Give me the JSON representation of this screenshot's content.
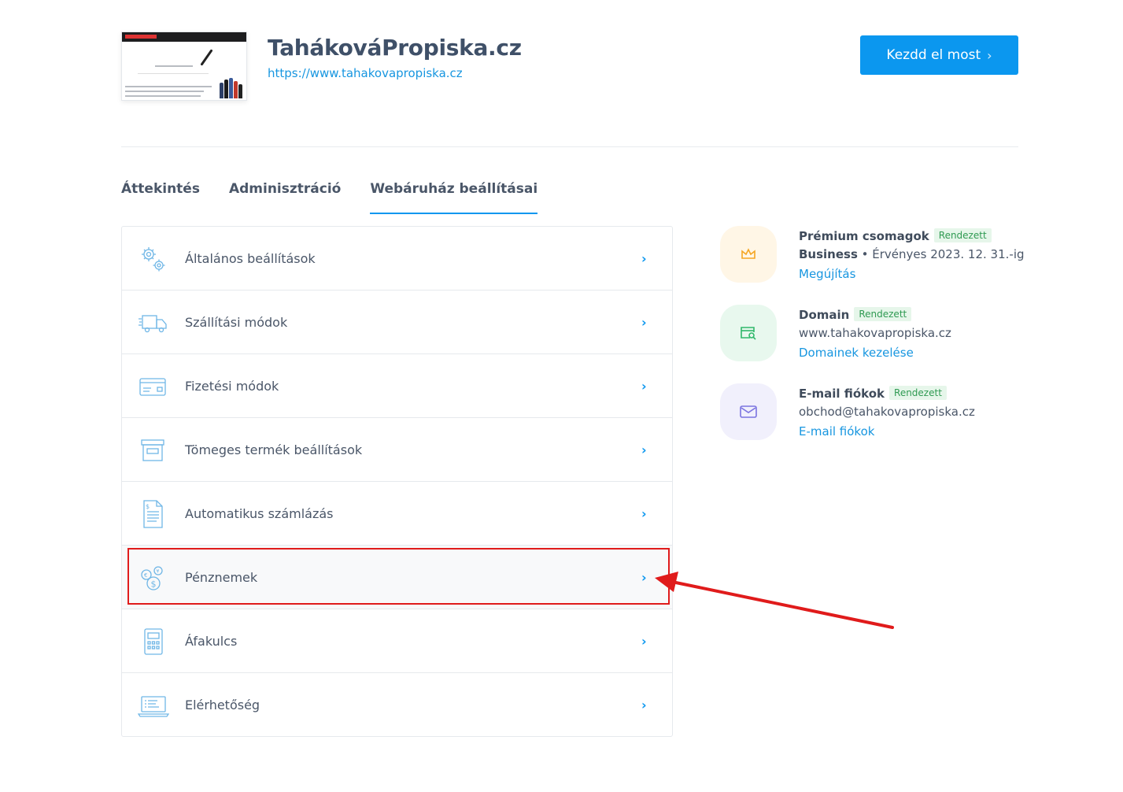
{
  "header": {
    "site_title": "TahákováPropiska.cz",
    "site_url": "https://www.tahakovapropiska.cz",
    "cta_label": "Kezdd el most",
    "cta_icon": "chevron-right-icon"
  },
  "tabs": [
    {
      "label": "Áttekintés",
      "active": false
    },
    {
      "label": "Adminisztráció",
      "active": false
    },
    {
      "label": "Webáruház beállításai",
      "active": true
    }
  ],
  "settings": [
    {
      "label": "Általános beállítások",
      "icon": "gears-icon"
    },
    {
      "label": "Szállítási módok",
      "icon": "truck-icon"
    },
    {
      "label": "Fizetési módok",
      "icon": "credit-card-icon"
    },
    {
      "label": "Tömeges termék beállítások",
      "icon": "box-icon"
    },
    {
      "label": "Automatikus számlázás",
      "icon": "invoice-icon"
    },
    {
      "label": "Pénznemek",
      "icon": "currency-coins-icon"
    },
    {
      "label": "Áfakulcs",
      "icon": "calculator-icon"
    },
    {
      "label": "Elérhetőség",
      "icon": "laptop-icon"
    }
  ],
  "services": [
    {
      "name": "Prémium csomagok",
      "badge": "Rendezett",
      "detail_strong": "Business",
      "detail_rest": " • Érvényes 2023. 12. 31.-ig",
      "link": "Megújítás",
      "icon": "crown-icon",
      "bg": "#fff6e6",
      "color": "#f5a623"
    },
    {
      "name": "Domain",
      "badge": "Rendezett",
      "detail_strong": "",
      "detail_rest": "www.tahakovapropiska.cz",
      "link": "Domainek kezelése",
      "icon": "domain-search-icon",
      "bg": "#e8f8ee",
      "color": "#2fb86a"
    },
    {
      "name": "E-mail fiókok",
      "badge": "Rendezett",
      "detail_strong": "",
      "detail_rest": "obchod@tahakovapropiska.cz",
      "link": "E-mail fiókok",
      "icon": "envelope-icon",
      "bg": "#f1f0fc",
      "color": "#7b74e0"
    }
  ],
  "colors": {
    "accent": "#0b97ef",
    "badge_green": "#2f9a52",
    "annotation_red": "#e01b1b"
  }
}
